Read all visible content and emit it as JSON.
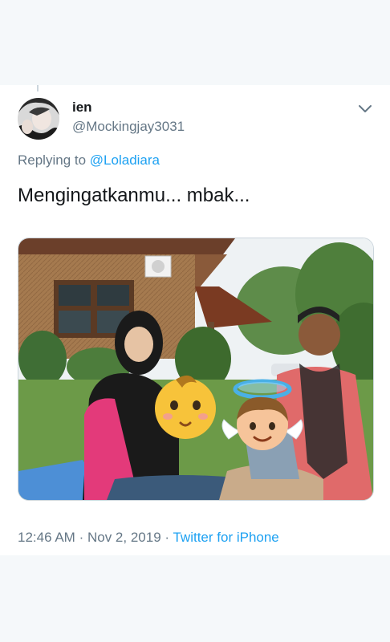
{
  "tweet": {
    "display_name": "ien",
    "handle": "@Mockingjay3031",
    "replying_prefix": "Replying to",
    "replying_to": "@Loladiara",
    "text": "Mengingatkanmu... mbak...",
    "time": "12:46 AM",
    "separator": "·",
    "date": "Nov 2, 2019",
    "source": "Twitter for iPhone"
  },
  "icons": {
    "menu": "chevron-down-icon",
    "baby_emoji": "baby-emoji",
    "angel_emoji": "baby-angel-emoji"
  },
  "colors": {
    "accent": "#1da1f2",
    "secondary_text": "#657786",
    "primary_text": "#14171a",
    "background": "#f5f8fa"
  }
}
